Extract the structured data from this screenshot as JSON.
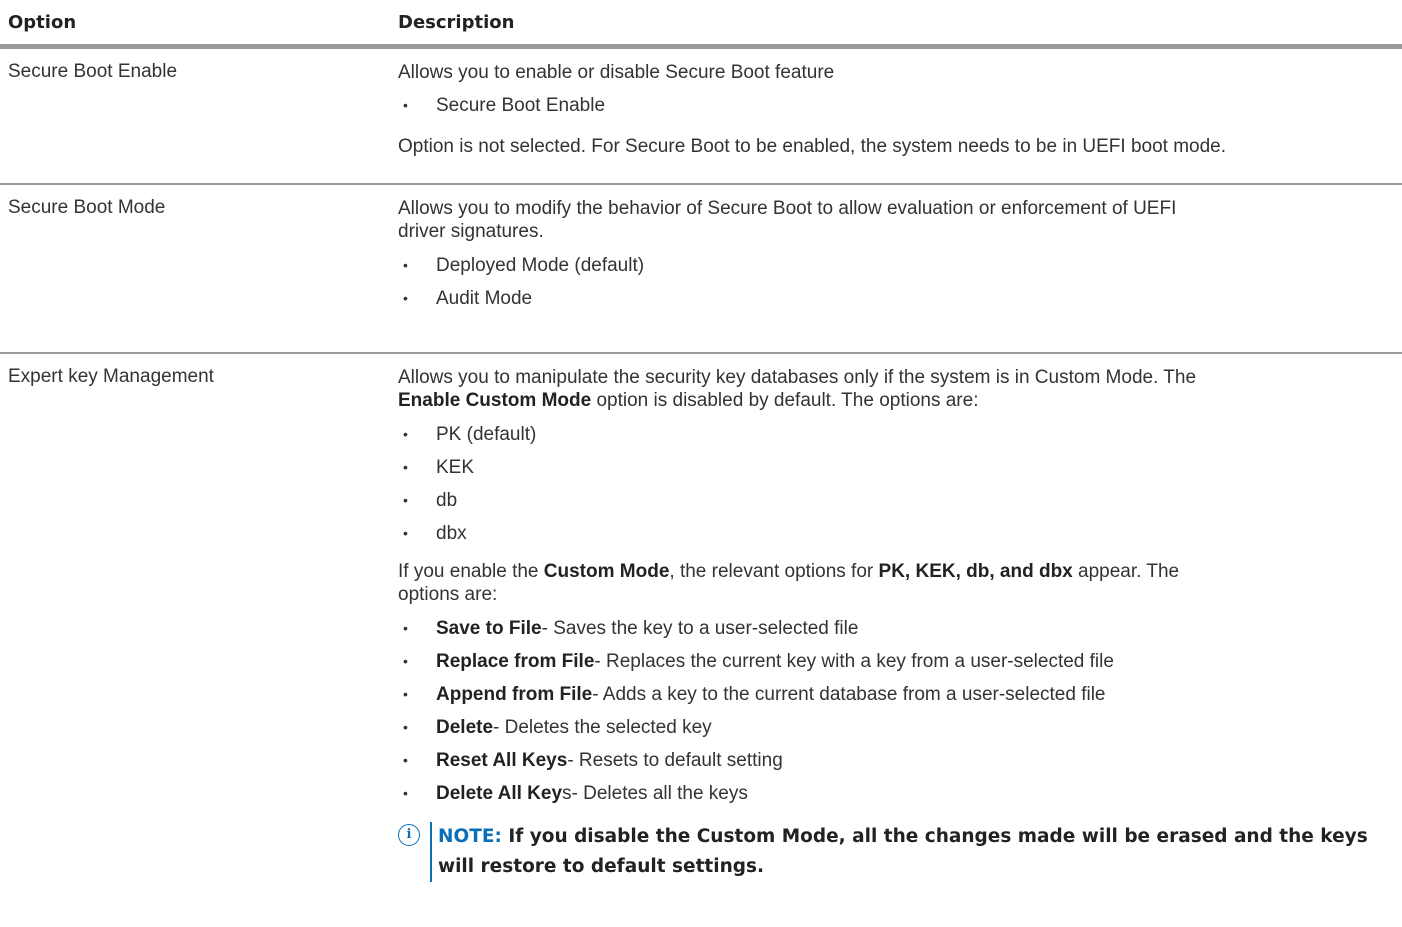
{
  "header": {
    "option_label": "Option",
    "description_label": "Description"
  },
  "rows": [
    {
      "option": "Secure Boot Enable",
      "intro": "Allows you to enable or disable Secure Boot feature",
      "bullets": [
        "Secure Boot Enable"
      ],
      "after": "Option is not selected. For Secure Boot to be enabled, the system needs to be in UEFI boot mode."
    },
    {
      "option": "Secure Boot Mode",
      "intro_line1": "Allows you to modify the behavior of Secure Boot to allow evaluation or enforcement of UEFI",
      "intro_line2": "driver signatures.",
      "bullets": [
        "Deployed Mode (default)",
        "Audit Mode"
      ]
    },
    {
      "option": "Expert key Management",
      "intro_line1": "Allows you to manipulate the security key databases only if the system is in Custom Mode. The",
      "intro_line2_bold": "Enable Custom Mode",
      "intro_line2_rest": " option is disabled by default. The options are:",
      "bullets": [
        "PK (default)",
        "KEK",
        "db",
        "dbx"
      ],
      "para2_pre": "If you enable the ",
      "para2_bold1": "Custom Mode",
      "para2_mid": ", the relevant options for ",
      "para2_bold2": "PK, KEK, db, and dbx",
      "para2_post": " appear. The",
      "para2_line2": "options are:",
      "custom_options": [
        {
          "bold": "Save to File",
          "text": "- Saves the key to a user-selected file"
        },
        {
          "bold": "Replace from File",
          "text": "- Replaces the current key with a key from a user-selected file"
        },
        {
          "bold": "Append from File",
          "text": "- Adds a key to the current database from a user-selected file"
        },
        {
          "bold": "Delete",
          "text": "- Deletes the selected key"
        },
        {
          "bold": "Reset All Keys",
          "text": "- Resets to default setting"
        },
        {
          "bold": "Delete All Key",
          "text": "s- Deletes all the keys"
        }
      ],
      "note_label": "NOTE:",
      "note_text": " If you disable the Custom Mode, all the changes made will be erased and the keys will restore to default settings."
    }
  ],
  "bullet_glyph": "•",
  "icons": {
    "note": "info-icon"
  },
  "colors": {
    "accent": "#0b6fb7",
    "rule": "#9a9a9a"
  }
}
